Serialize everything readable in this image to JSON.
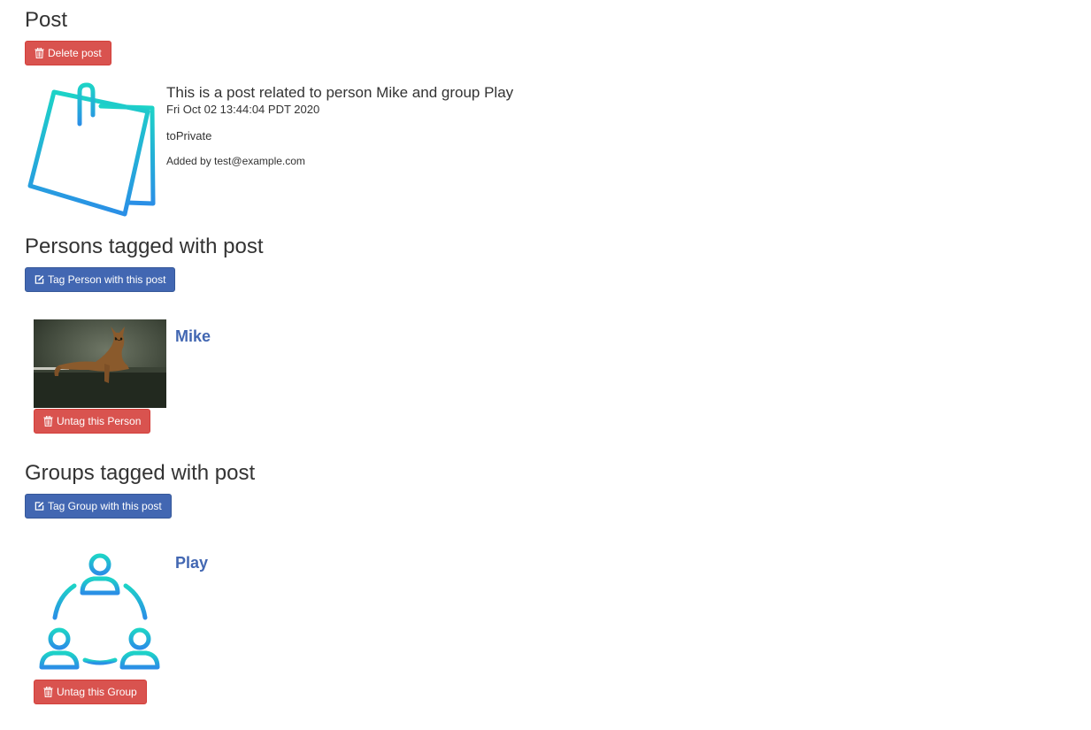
{
  "post": {
    "heading": "Post",
    "delete_label": "Delete post",
    "title": "This is a post related to person Mike and group Play",
    "date": "Fri Oct 02 13:44:04 PDT 2020",
    "visibility": "toPrivate",
    "added_by": "Added by test@example.com",
    "icon": "sticky-note-icon"
  },
  "persons": {
    "heading": "Persons tagged with post",
    "tag_label": "Tag Person with this post",
    "items": [
      {
        "name": "Mike",
        "untag_label": "Untag this Person",
        "image": "cat-photo"
      }
    ]
  },
  "groups": {
    "heading": "Groups tagged with post",
    "tag_label": "Tag Group with this post",
    "items": [
      {
        "name": "Play",
        "untag_label": "Untag this Group",
        "icon": "group-people-icon"
      }
    ]
  },
  "colors": {
    "danger": "#d9534f",
    "primary": "#4267b2",
    "link": "#4267b2",
    "icon_gradient_top": "#1dd3c7",
    "icon_gradient_bottom": "#2a8fe6"
  }
}
